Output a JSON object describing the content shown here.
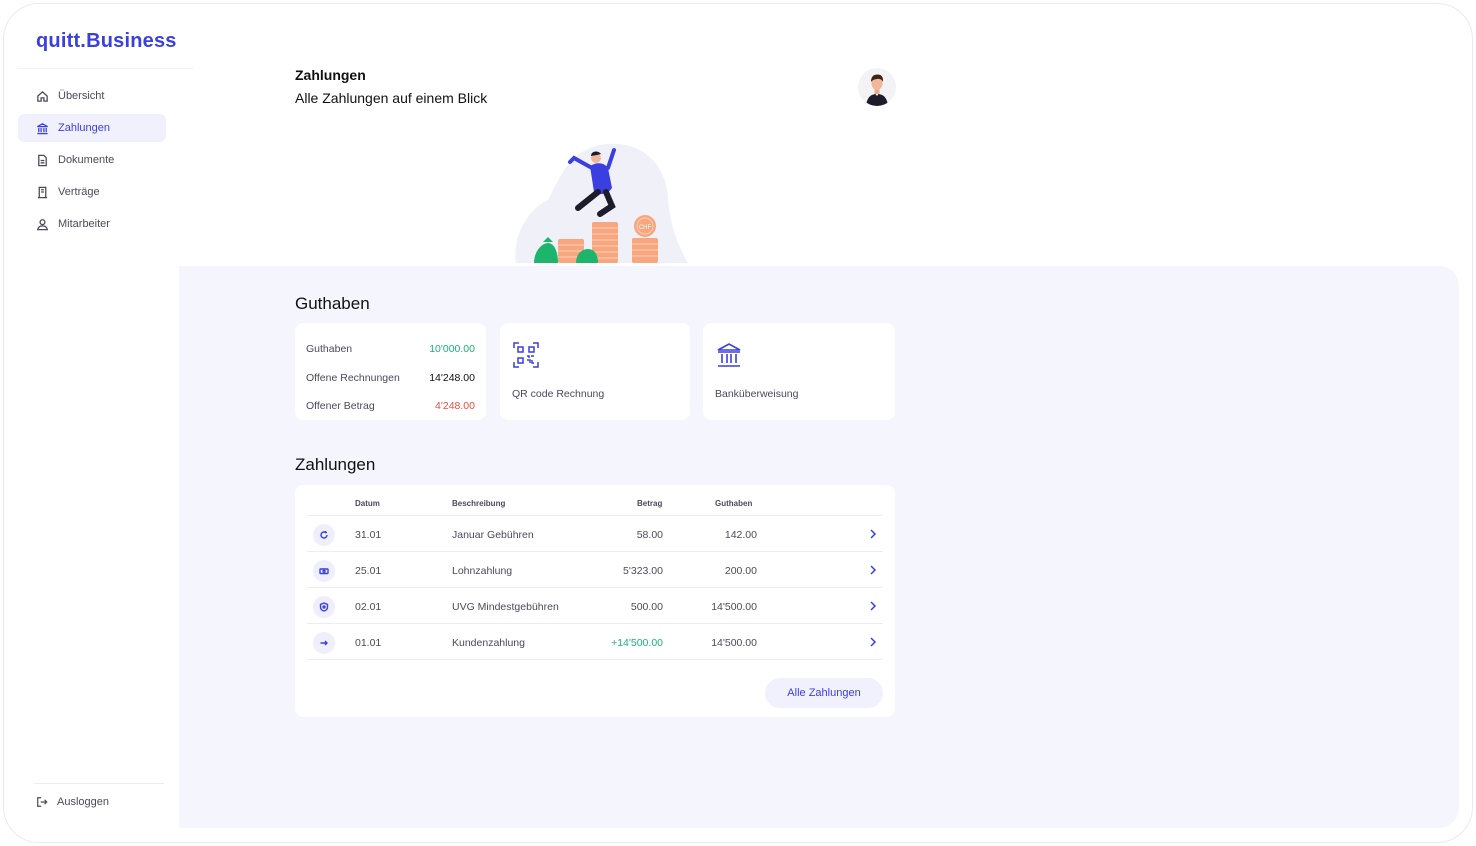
{
  "app": {
    "logo": "quitt.Business"
  },
  "sidebar": {
    "items": [
      {
        "label": "Übersicht",
        "icon": "home-icon",
        "active": false
      },
      {
        "label": "Zahlungen",
        "icon": "bank-icon",
        "active": true
      },
      {
        "label": "Dokumente",
        "icon": "document-icon",
        "active": false
      },
      {
        "label": "Verträge",
        "icon": "contract-icon",
        "active": false
      },
      {
        "label": "Mitarbeiter",
        "icon": "user-icon",
        "active": false
      }
    ],
    "logout": "Ausloggen"
  },
  "header": {
    "title": "Zahlungen",
    "subtitle": "Alle Zahlungen auf einem Blick"
  },
  "illustration": {
    "coin_label": "CHF"
  },
  "guthaben": {
    "title": "Guthaben",
    "rows": [
      {
        "label": "Guthaben",
        "value": "10'000.00",
        "color": "#19b27a"
      },
      {
        "label": "Offene Rechnungen",
        "value": "14'248.00",
        "color": "#111111"
      },
      {
        "label": "Offener Betrag",
        "value": "4'248.00",
        "color": "#ef4c3c"
      }
    ],
    "actions": [
      {
        "label": "QR code Rechnung",
        "icon": "qr-code-icon"
      },
      {
        "label": "Banküberweisung",
        "icon": "bank-transfer-icon"
      }
    ]
  },
  "zahlungen": {
    "title": "Zahlungen",
    "columns": {
      "datum": "Datum",
      "beschreibung": "Beschreibung",
      "betrag": "Betrag",
      "guthaben": "Guthaben"
    },
    "rows": [
      {
        "icon": "refresh-icon",
        "datum": "31.01",
        "beschreibung": "Januar Gebühren",
        "betrag": "58.00",
        "guthaben": "142.00",
        "positive": false
      },
      {
        "icon": "money-icon",
        "datum": "25.01",
        "beschreibung": "Lohnzahlung",
        "betrag": "5'323.00",
        "guthaben": "200.00",
        "positive": false
      },
      {
        "icon": "shield-icon",
        "datum": "02.01",
        "beschreibung": "UVG Mindestgebühren",
        "betrag": "500.00",
        "guthaben": "14'500.00",
        "positive": false
      },
      {
        "icon": "arrow-right-icon",
        "datum": "01.01",
        "beschreibung": "Kundenzahlung",
        "betrag": "+14'500.00",
        "guthaben": "14'500.00",
        "positive": true
      }
    ],
    "all_button": "Alle Zahlungen"
  },
  "colors": {
    "accent": "#3a3fe0",
    "panel": "#f5f5fd",
    "positive": "#19b27a",
    "negative": "#ef4c3c"
  }
}
